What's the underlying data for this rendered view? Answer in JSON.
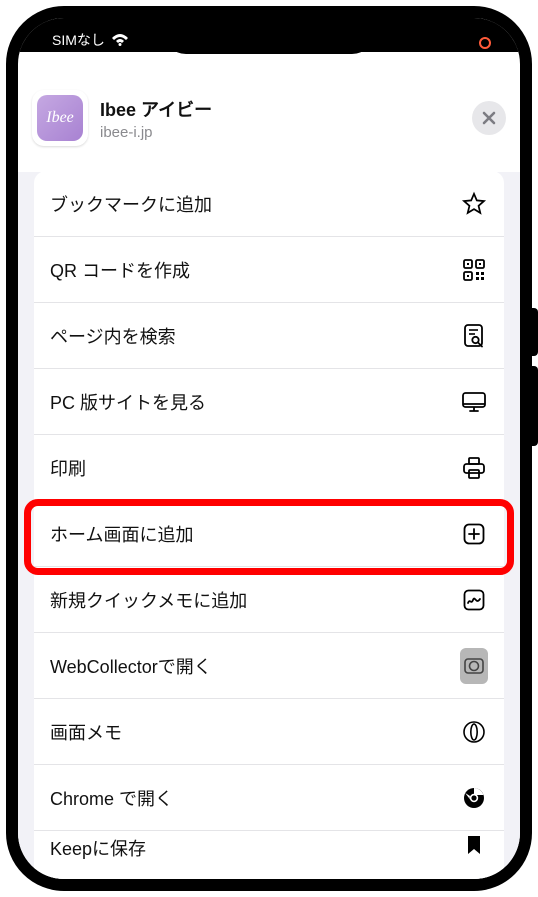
{
  "status": {
    "carrier": "SIMなし",
    "recording": true
  },
  "header": {
    "app_icon_text": "Ibee",
    "title": "Ibee アイビー",
    "subtitle": "ibee-i.jp"
  },
  "menu": {
    "items": [
      {
        "label": "ブックマークに追加",
        "icon": "star-icon"
      },
      {
        "label": "QR コードを作成",
        "icon": "qr-icon"
      },
      {
        "label": "ページ内を検索",
        "icon": "page-search-icon"
      },
      {
        "label": "PC 版サイトを見る",
        "icon": "desktop-icon"
      },
      {
        "label": "印刷",
        "icon": "printer-icon"
      },
      {
        "label": "ホーム画面に追加",
        "icon": "add-square-icon",
        "highlight": true
      },
      {
        "label": "新規クイックメモに追加",
        "icon": "quicknote-icon"
      },
      {
        "label": "WebCollectorで開く",
        "icon": "webcollector-icon"
      },
      {
        "label": "画面メモ",
        "icon": "screenmemo-icon"
      },
      {
        "label": "Chrome で開く",
        "icon": "chrome-icon"
      },
      {
        "label": "Keepに保存",
        "icon": "keep-icon",
        "partial": true
      }
    ]
  }
}
